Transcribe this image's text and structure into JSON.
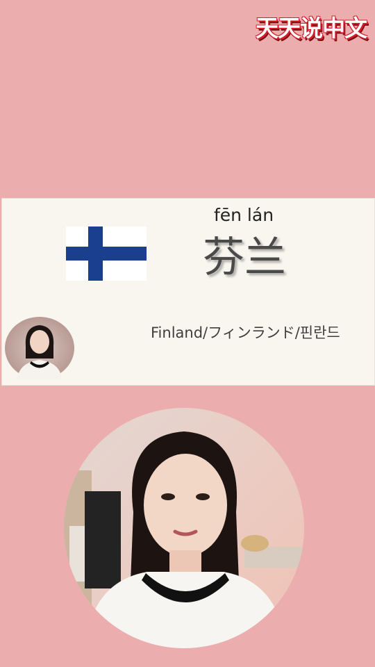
{
  "logo": {
    "text": "天天说中文"
  },
  "card": {
    "pinyin": "fēn lán",
    "hanzi": "芬兰",
    "translation": "Finland/フィンランド/핀란드",
    "flag_icon": "finland-flag-icon"
  },
  "colors": {
    "background": "#ebadad",
    "card": "#f8f6ee",
    "flag_blue": "#1b3f8f"
  }
}
